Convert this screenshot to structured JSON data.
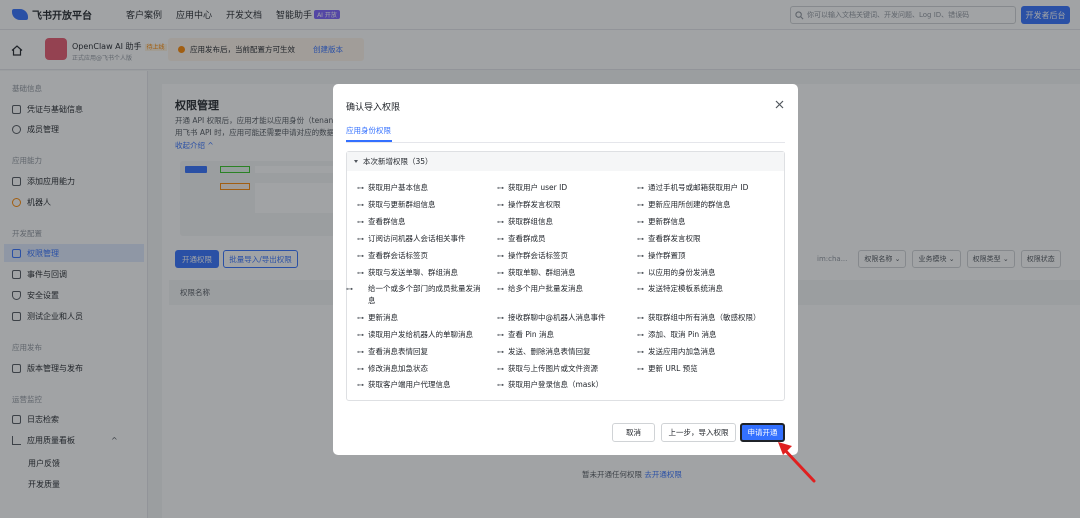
{
  "topnav": {
    "brand": "飞书开放平台",
    "links": [
      "客户案例",
      "应用中心",
      "开发文档",
      "智能助手"
    ],
    "ai_badge": "AI 开放",
    "search_placeholder": "你可以输入文档关键词、开发问题、Log ID、错误码",
    "dev_console": "开发者后台"
  },
  "appbar": {
    "app_name": "OpenClaw AI 助手",
    "app_tag": "待上线",
    "app_sub": "正式应用@飞书个人版",
    "notice": "应用发布后，当前配置方可生效",
    "notice_link": "创建版本"
  },
  "sidebar": {
    "sections": [
      "基础信息",
      "应用能力",
      "开发配置",
      "应用发布",
      "运营监控"
    ],
    "items": [
      "凭证与基础信息",
      "成员管理",
      "添加应用能力",
      "机器人",
      "权限管理",
      "事件与回调",
      "安全设置",
      "测试企业和人员",
      "版本管理与发布",
      "日志检索",
      "应用质量看板"
    ],
    "sub_items": [
      "用户反馈",
      "开发质量"
    ]
  },
  "main": {
    "title": "权限管理",
    "desc_1": "开通 API 权限后，应用才能以应用身份（tenant_access_token）",
    "desc_2": "用飞书 API 时，应用可能还需要申请对应的数据权限",
    "collapse": "收起介绍",
    "apply_btn": "开通权限",
    "batch_btn": "批量导入/导出权限",
    "filter_search": "im:cha...",
    "filters": [
      "权限名称",
      "业务模块",
      "权限类型",
      "权限状态"
    ],
    "col_name": "权限名称",
    "empty": "暂未开通任何权限",
    "empty_link": "去开通权限"
  },
  "modal": {
    "title": "确认导入权限",
    "tab": "应用身份权限",
    "group": "本次新增权限（35）",
    "col1": [
      "获取用户基本信息",
      "获取与更新群组信息",
      "查看群信息",
      "订阅访问机器人会话相关事件",
      "查看群会话标签页",
      "获取与发送单聊、群组消息",
      "给一个或多个部门的成员批量发消息",
      "更新消息",
      "读取用户发给机器人的单聊消息",
      "查看消息表情回复",
      "修改消息加急状态",
      "获取客户端用户代理信息"
    ],
    "col2": [
      "获取用户 user ID",
      "操作群发言权限",
      "获取群组信息",
      "查看群成员",
      "操作群会话标签页",
      "获取单聊、群组消息",
      "给多个用户批量发消息",
      "接收群聊中@机器人消息事件",
      "查看 Pin 消息",
      "发送、删除消息表情回复",
      "获取与上传图片或文件资源",
      "获取用户登录信息（mask）"
    ],
    "col3": [
      "通过手机号或邮箱获取用户 ID",
      "更新应用所创建的群信息",
      "更新群信息",
      "查看群发言权限",
      "操作群置顶",
      "以应用的身份发消息",
      "发送特定模板系统消息",
      "获取群组中所有消息（敏感权限）",
      "添加、取消 Pin 消息",
      "发送应用内加急消息",
      "更新 URL 预览"
    ],
    "cancel": "取消",
    "prev": "上一步，导入权限",
    "ok": "申请开通"
  },
  "colors": {
    "primary": "#3370ff",
    "arrow": "#e02020"
  }
}
